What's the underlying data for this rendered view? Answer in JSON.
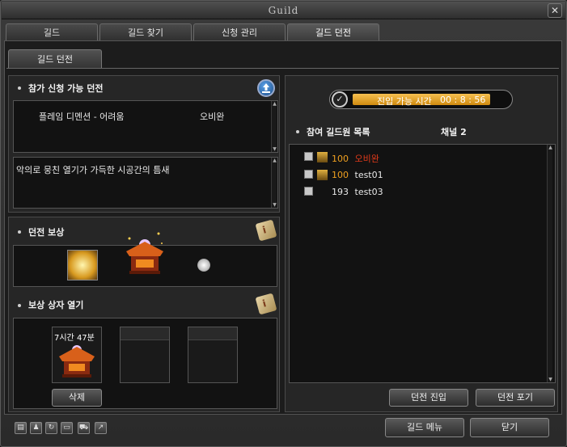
{
  "window": {
    "title": "Guild"
  },
  "tabs": [
    {
      "label": "길드"
    },
    {
      "label": "길드 찾기"
    },
    {
      "label": "신청 관리"
    },
    {
      "label": "길드 던전"
    }
  ],
  "subtab": {
    "label": "길드 던전"
  },
  "dungeon_list": {
    "header": "참가 신청 가능 던전",
    "entry_name": "플레임 디멘션 - 어려움",
    "entry_applicant": "오비완",
    "description": "악의로 뭉친 열기가 가득한 시공간의 틈새"
  },
  "reward": {
    "header": "던전 보상"
  },
  "reward_box": {
    "header": "보상 상자 열기",
    "timer_text": "7시간 47분",
    "delete_label": "삭제"
  },
  "entry_time": {
    "label": "진입 가능 시간",
    "value": "00 : 8 : 56",
    "progress": 0.85
  },
  "members": {
    "header": "참여 길드원 목록",
    "channel": "채널 2",
    "list": [
      {
        "level": "100",
        "name": "오비완",
        "name_color": "#e03a1a",
        "level_color": "#f0a020"
      },
      {
        "level": "100",
        "name": "test01",
        "name_color": "#e8e8e8",
        "level_color": "#f0a020"
      },
      {
        "level": "193",
        "name": "test03",
        "name_color": "#e8e8e8",
        "level_color": "#e8e8e8"
      }
    ]
  },
  "buttons": {
    "enter_dungeon": "던전 진입",
    "give_up_dungeon": "던전 포기",
    "guild_menu": "길드 메뉴",
    "close": "닫기"
  },
  "icons": {
    "close": "close-icon",
    "info": "scroll-icon",
    "upload": "upload-icon"
  }
}
